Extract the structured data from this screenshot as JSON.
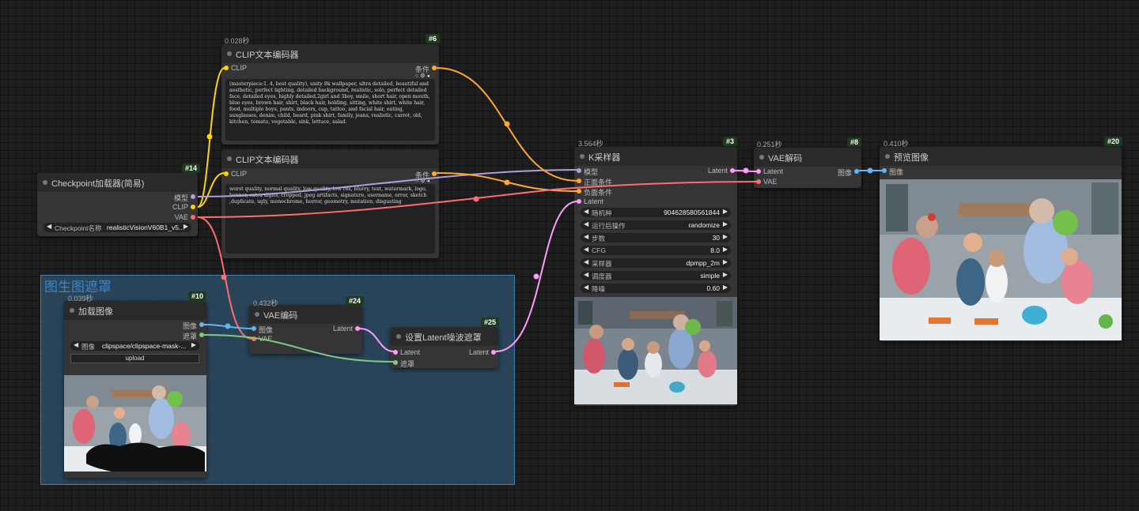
{
  "colors": {
    "clip": "#ffd500",
    "conditioning": "#ffa931",
    "model": "#b39ddb",
    "vae": "#ff6e6e",
    "latent": "#ff9cf9",
    "image": "#64b5f6",
    "mask": "#81c784"
  },
  "group": {
    "title": "图生图遮罩"
  },
  "nodes": {
    "clip_pos": {
      "id": "#6",
      "timing": "0.028秒",
      "title": "CLIP文本编码器",
      "in_clip": "CLIP",
      "out_cond": "条件",
      "text": "(masterpiece:1. 4, best quality), unity 8k wallpaper, ultra detailed, beautiful and aesthetic, perfect lighting, detailed background, realistic, solo, perfect detailed face, detailed eyes, highly detailed,2girl and 3boy, smile, short hair, open mouth, blue eyes, brown hair, shirt, black hair, holding, sitting, white shirt, white hair, food, multiple boys, pants, indoors, cup, tattoo, and facial hair, eating, sunglasses, denim, child, beard, pink shirt, family, jeans, realistic, carrot, old, kitchen, tomato, vegetable, sink, lettuce, salad."
    },
    "clip_neg": {
      "title": "CLIP文本编码器",
      "in_clip": "CLIP",
      "out_cond": "条件",
      "text": "worst quality, normal quality, low quality, low res, blurry, text, watermark, logo, banner, extra digits, cropped, jpeg artifacts, signature, username, error, sketch ,duplicate, ugly, monochrome, horror, geometry, mutation, disgusting"
    },
    "checkpoint": {
      "id": "#14",
      "title": "Checkpoint加载器(简易)",
      "out_model": "模型",
      "out_clip": "CLIP",
      "out_vae": "VAE",
      "widget_label": "Checkpoint名称",
      "widget_value": "realisticVisionV60B1_v5..."
    },
    "ksampler": {
      "id": "#3",
      "timing": "3.564秒",
      "title": "K采样器",
      "in_model": "模型",
      "in_pos": "正面条件",
      "in_neg": "负面条件",
      "in_latent": "Latent",
      "out_latent": "Latent",
      "widgets": [
        {
          "label": "随机种",
          "value": "904628580561844"
        },
        {
          "label": "运行后操作",
          "value": "randomize"
        },
        {
          "label": "步数",
          "value": "30"
        },
        {
          "label": "CFG",
          "value": "8.0"
        },
        {
          "label": "采样器",
          "value": "dpmpp_2m"
        },
        {
          "label": "调度器",
          "value": "simple"
        },
        {
          "label": "降噪",
          "value": "0.60"
        }
      ]
    },
    "vae_decode": {
      "id": "#8",
      "timing": "0.251秒",
      "title": "VAE解码",
      "in_latent": "Latent",
      "in_vae": "VAE",
      "out_image": "图像"
    },
    "preview": {
      "id": "#20",
      "timing": "0.410秒",
      "title": "预览图像",
      "in_image": "图像"
    },
    "load_image": {
      "id": "#10",
      "timing": "0.039秒",
      "title": "加载图像",
      "out_image": "图像",
      "out_mask": "遮罩",
      "widget_label": "图像",
      "widget_value": "clipspace/clipspace-mask-...",
      "upload": "upload"
    },
    "vae_encode": {
      "id": "#24",
      "timing": "0.432秒",
      "title": "VAE编码",
      "in_image": "图像",
      "in_vae": "VAE",
      "out_latent": "Latent"
    },
    "set_mask": {
      "id": "#25",
      "title": "设置Latent噪波遮罩",
      "in_latent": "Latent",
      "in_mask": "遮罩",
      "out_latent": "Latent"
    }
  }
}
